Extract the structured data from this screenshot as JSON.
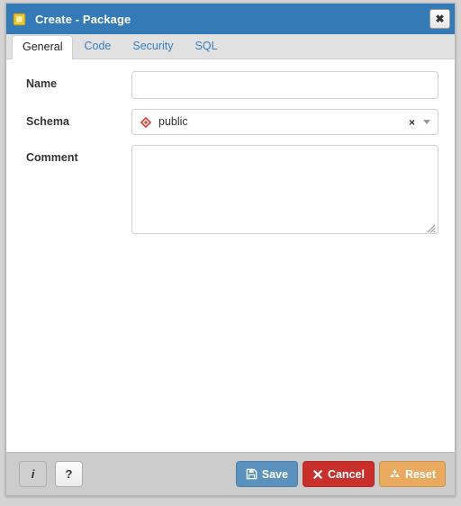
{
  "window": {
    "title": "Create - Package",
    "icon": "package-icon",
    "close_label": "✖",
    "accent_color": "#337ab7"
  },
  "tabs": [
    {
      "label": "General",
      "active": true
    },
    {
      "label": "Code",
      "active": false
    },
    {
      "label": "Security",
      "active": false
    },
    {
      "label": "SQL",
      "active": false
    }
  ],
  "form": {
    "name": {
      "label": "Name",
      "value": "",
      "placeholder": ""
    },
    "schema": {
      "label": "Schema",
      "value": "public",
      "icon": "schema-diamond-icon",
      "icon_color": "#d9453c",
      "clear_label": "×",
      "arrow": "chevron-down-icon"
    },
    "comment": {
      "label": "Comment",
      "value": "",
      "placeholder": ""
    }
  },
  "footer": {
    "info_label": "i",
    "help_label": "?",
    "buttons": [
      {
        "label": "Save",
        "icon": "floppy-disk-icon",
        "color": "#5b92bd"
      },
      {
        "label": "Cancel",
        "icon": "cross-icon",
        "color": "#c9302c"
      },
      {
        "label": "Reset",
        "icon": "recycle-icon",
        "color": "#eaaa5f"
      }
    ]
  }
}
